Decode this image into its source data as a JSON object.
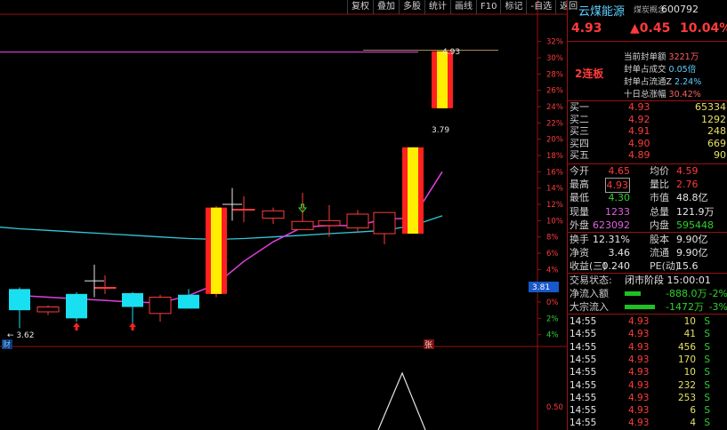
{
  "toolbar": [
    "复权",
    "叠加",
    "多股",
    "统计",
    "画线",
    "F10",
    "标记",
    "-自选",
    "返回"
  ],
  "chart_data": {
    "type": "candlestick",
    "price_axis": {
      "min": -5,
      "max": 33
    },
    "y_ticks": [
      "32%",
      "30%",
      "28%",
      "26%",
      "24%",
      "22%",
      "20%",
      "18%",
      "16%",
      "14%",
      "12%",
      "10%",
      "8%",
      "6%",
      "4%",
      "2%",
      "0%",
      "2%",
      "4%"
    ],
    "indicator_ticks": [
      "0.50"
    ],
    "candles": [
      {
        "open": 1.6,
        "close": -1.0,
        "high": 1.8,
        "low": -3.2
      },
      {
        "open": -1.2,
        "close": -0.6,
        "high": -0.4,
        "low": -1.6
      },
      {
        "open": 1.0,
        "close": -2.0,
        "high": 1.2,
        "low": -2.4
      },
      {
        "open": 1.7,
        "close": 1.8,
        "high": 3.3,
        "low": 1.0
      },
      {
        "open": 1.1,
        "close": -0.6,
        "high": 1.2,
        "low": -2.6
      },
      {
        "open": -1.4,
        "close": 0.6,
        "high": 0.9,
        "low": -2.4
      },
      {
        "open": 0.9,
        "close": -0.8,
        "high": 1.6,
        "low": -0.8
      },
      {
        "open": 1.0,
        "close": 11.6,
        "high": 11.8,
        "low": 0.6
      },
      {
        "open": 11.4,
        "close": 11.4,
        "high": 13.0,
        "low": 9.8
      },
      {
        "open": 10.3,
        "close": 11.2,
        "high": 11.6,
        "low": 9.6
      },
      {
        "open": 8.9,
        "close": 9.9,
        "high": 13.4,
        "low": 9.1
      },
      {
        "open": 9.4,
        "close": 10.0,
        "high": 11.9,
        "low": 8.0
      },
      {
        "open": 9.1,
        "close": 10.8,
        "high": 11.3,
        "low": 8.7
      },
      {
        "open": 8.4,
        "close": 11.0,
        "high": 11.0,
        "low": 7.1
      },
      {
        "open": 8.4,
        "close": 19.0,
        "high": 19.0,
        "low": 8.4
      },
      {
        "open": 23.8,
        "close": 30.8,
        "high": 30.8,
        "low": 23.8
      }
    ],
    "ma_slow": [
      9.0,
      8.8,
      8.6,
      8.4,
      8.2,
      8.0,
      7.8,
      7.7,
      7.8,
      8.0,
      8.2,
      8.4,
      8.6,
      8.8,
      9.4,
      10.6
    ],
    "ma_fast": [
      0.8,
      0.6,
      0.4,
      0.2,
      0.0,
      -0.1,
      0.8,
      2.2,
      5.0,
      7.4,
      9.2,
      9.4,
      9.4,
      10.2,
      10.3,
      16.0
    ],
    "upper_line": 30.7,
    "annotations": {
      "high_label": "4.93",
      "mid_label": "3.79",
      "low_label": "3.62",
      "side_price": "3.81",
      "bottom_left": "财",
      "bottom_mid": "张"
    },
    "up_arrows": [
      2,
      4
    ],
    "down_arrows": [
      10
    ],
    "volume_peak": 0.62
  },
  "stock": {
    "name": "云煤能源",
    "concept": "煤炭概念",
    "code": "600792",
    "price": "4.93",
    "change": "▲0.45",
    "change_pct": "10.04%",
    "limit_tag": "2连板",
    "seal_buy": "当前封单额",
    "seal_buy_val": "3221万",
    "seal_deal": "封单占成交",
    "seal_deal_val": "0.05倍",
    "seal_float": "封单占流通Z",
    "seal_float_val": "2.24%",
    "ten_day": "十日总涨幅",
    "ten_day_val": "30.42%"
  },
  "orderbook": [
    {
      "label": "买一",
      "price": "4.93",
      "vol": "65334"
    },
    {
      "label": "买二",
      "price": "4.92",
      "vol": "1292"
    },
    {
      "label": "买三",
      "price": "4.91",
      "vol": "248"
    },
    {
      "label": "买四",
      "price": "4.90",
      "vol": "669"
    },
    {
      "label": "买五",
      "price": "4.89",
      "vol": "90"
    }
  ],
  "stats": [
    {
      "l1": "今开",
      "v1": "4.65",
      "l2": "均价",
      "v2": "4.59"
    },
    {
      "l1": "最高",
      "v1": "4.93",
      "l2": "量比",
      "v2": "2.76"
    },
    {
      "l1": "最低",
      "v1": "4.30",
      "l2": "市值",
      "v2": "48.8亿"
    },
    {
      "l1": "现量",
      "v1": "1233",
      "l2": "总量",
      "v2": "121.9万"
    },
    {
      "l1": "外盘",
      "v1": "623092",
      "l2": "内盘",
      "v2": "595448"
    }
  ],
  "stats2": [
    {
      "l1": "换手",
      "v1": "12.31%",
      "l2": "股本",
      "v2": "9.90亿"
    },
    {
      "l1": "净资",
      "v1": "3.46",
      "l2": "流通",
      "v2": "9.90亿"
    },
    {
      "l1": "收益(三)",
      "v1": "0.240",
      "l2": "PE(动)",
      "v2": "15.6"
    }
  ],
  "status": {
    "label": "交易状态:",
    "value": "闭市阶段 15:00:01"
  },
  "flows": [
    {
      "label": "净流入额",
      "value": "-888.0万",
      "pct": "-2%",
      "bar": 0.45
    },
    {
      "label": "大宗流入",
      "value": "-1472万",
      "pct": "-3%",
      "bar": 0.85
    }
  ],
  "trades": [
    {
      "t": "14:55",
      "p": "4.93",
      "v": "10",
      "s": "S"
    },
    {
      "t": "14:55",
      "p": "4.93",
      "v": "41",
      "s": "S"
    },
    {
      "t": "14:55",
      "p": "4.93",
      "v": "456",
      "s": "S"
    },
    {
      "t": "14:55",
      "p": "4.93",
      "v": "170",
      "s": "S"
    },
    {
      "t": "14:55",
      "p": "4.93",
      "v": "10",
      "s": "S"
    },
    {
      "t": "14:55",
      "p": "4.93",
      "v": "232",
      "s": "S"
    },
    {
      "t": "14:55",
      "p": "4.93",
      "v": "253",
      "s": "S"
    },
    {
      "t": "14:55",
      "p": "4.93",
      "v": "6",
      "s": "S"
    },
    {
      "t": "14:55",
      "p": "4.93",
      "v": "4",
      "s": "S"
    }
  ]
}
